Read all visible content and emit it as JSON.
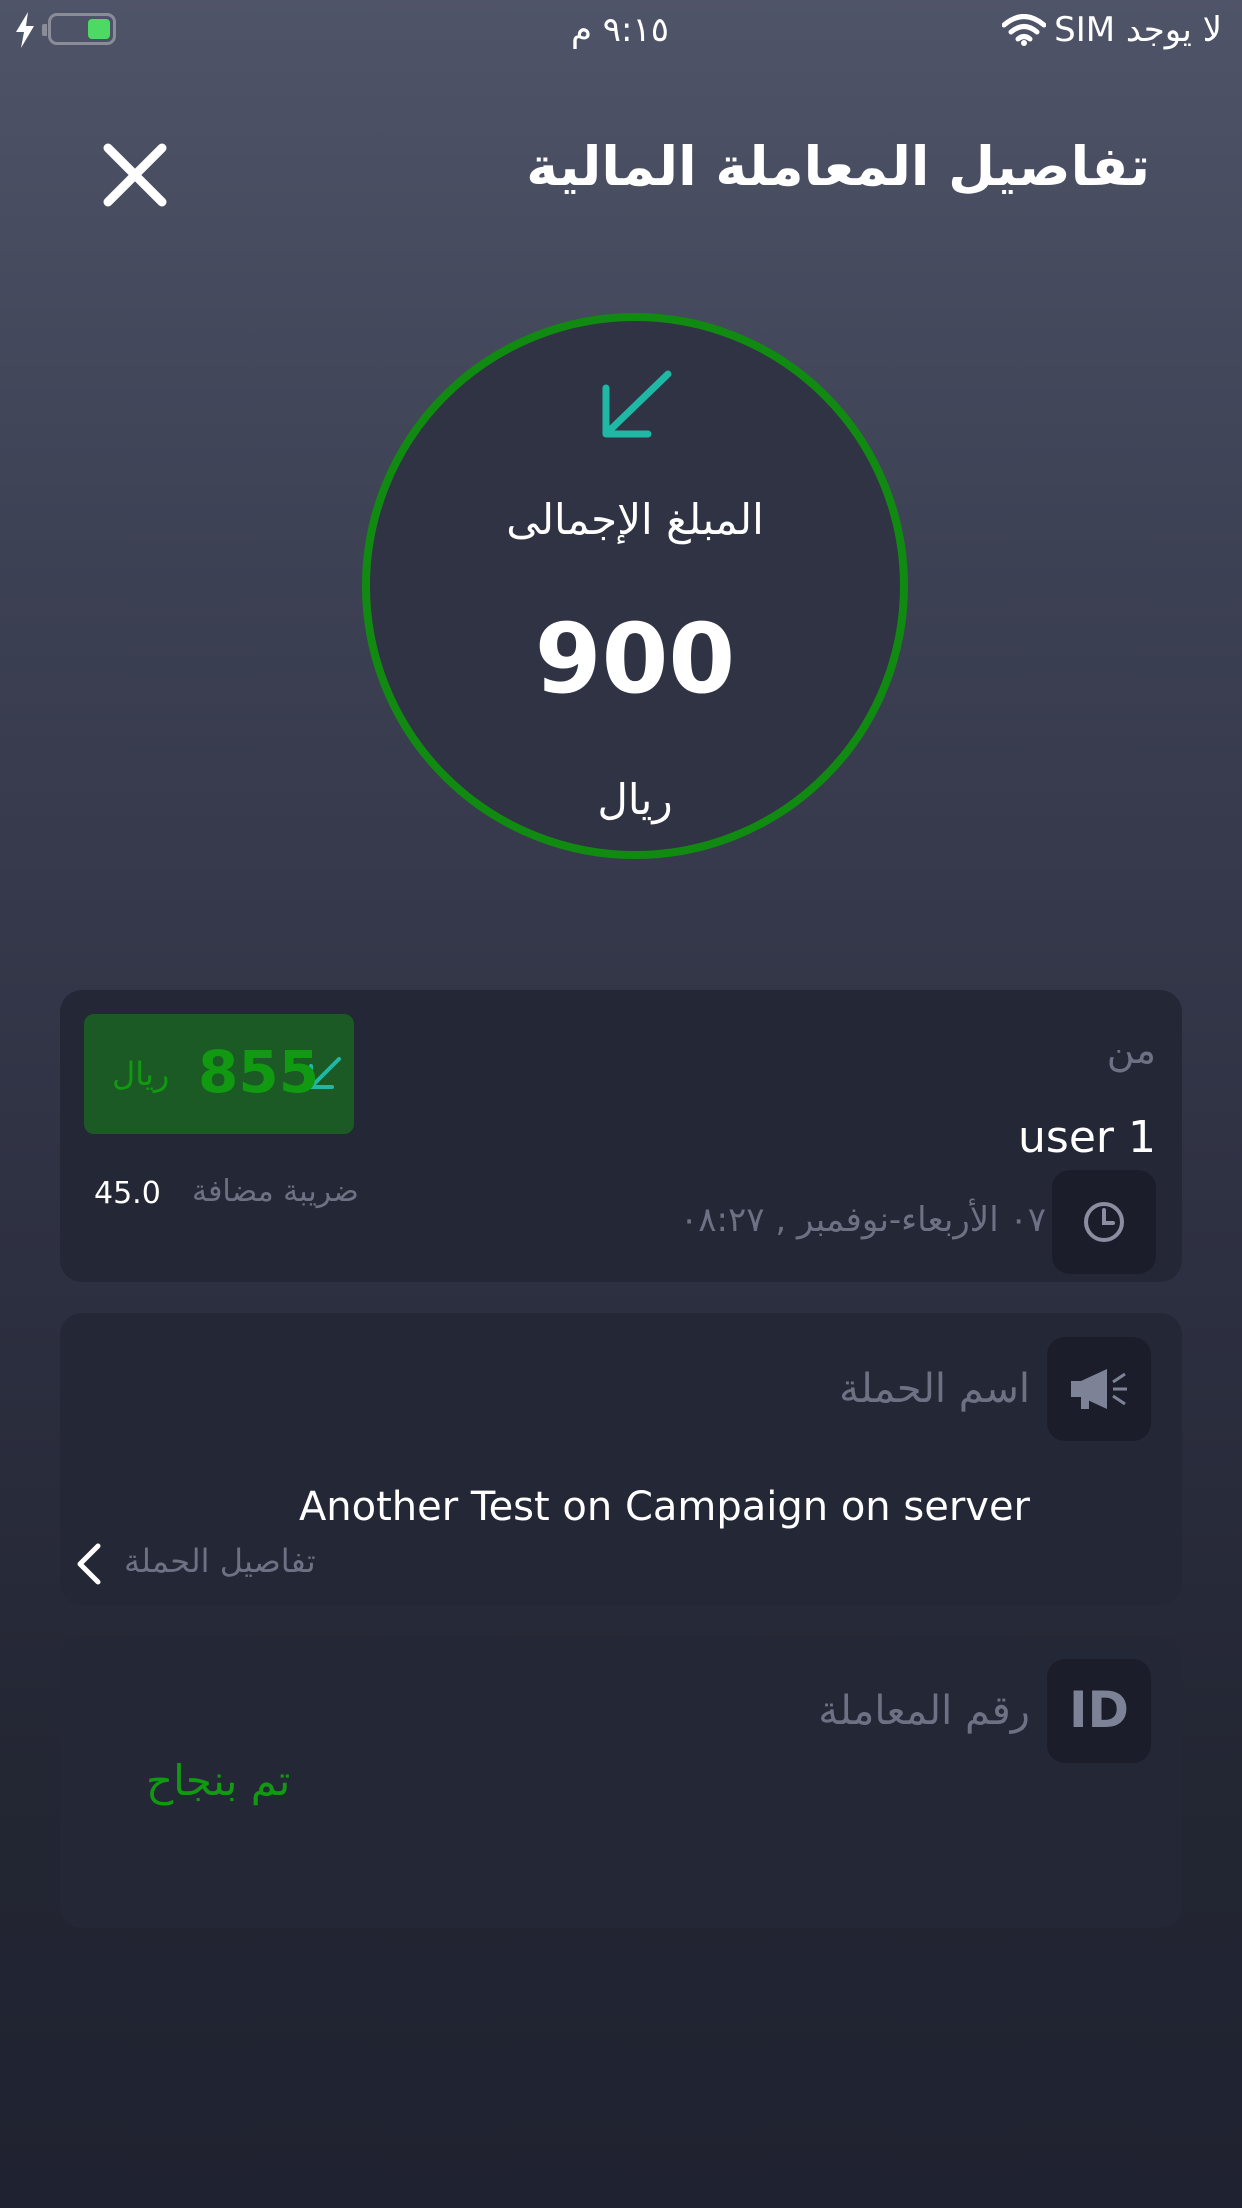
{
  "status_bar": {
    "carrier": "لا يوجد SIM",
    "time": "٩:١٥ م",
    "battery_level": 0.4
  },
  "header": {
    "title": "تفاصيل المعاملة المالية",
    "close_icon": "close-icon"
  },
  "summary": {
    "label": "المبلغ الإجمالى",
    "amount": "900",
    "currency": "ريال",
    "direction_icon": "incoming-arrow-icon"
  },
  "sender_card": {
    "label": "من",
    "name": "user 1",
    "date": "٠٧ الأربعاء-نوفمبر , ٠٨:٢٧",
    "clock_icon": "clock-icon",
    "net_amount": "855",
    "net_currency": "ريال",
    "vat_label": "ضريبة مضافة",
    "vat_value": "45.0"
  },
  "campaign_card": {
    "label": "اسم الحملة",
    "name": "Another Test on Campaign on server",
    "details_link": "تفاصيل الحملة",
    "icon": "megaphone-icon"
  },
  "transaction_card": {
    "label": "رقم المعاملة",
    "icon_text": "ID",
    "status": "تم بنجاح"
  },
  "colors": {
    "success_green": "#118a11",
    "arrow_teal": "#1fb8a5",
    "card_bg": "#242735"
  }
}
